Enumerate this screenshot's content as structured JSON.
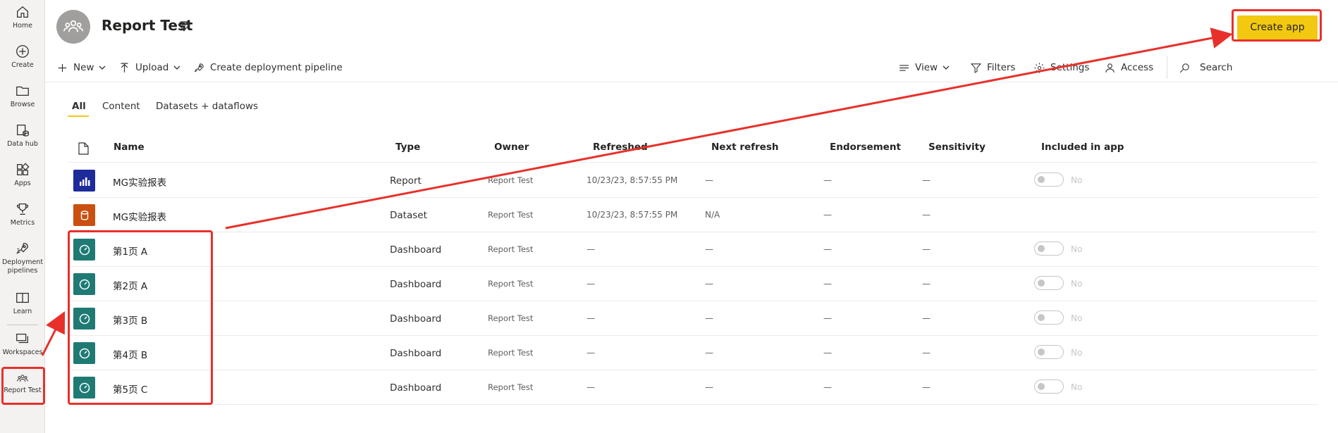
{
  "nav": [
    {
      "label": "Home",
      "icon": "home-icon"
    },
    {
      "label": "Create",
      "icon": "plus-circle-icon"
    },
    {
      "label": "Browse",
      "icon": "folder-icon"
    },
    {
      "label": "Data hub",
      "icon": "data-hub-icon"
    },
    {
      "label": "Apps",
      "icon": "apps-icon"
    },
    {
      "label": "Metrics",
      "icon": "trophy-icon"
    },
    {
      "label": "Deployment pipelines",
      "icon": "rocket-icon"
    },
    {
      "label": "Learn",
      "icon": "book-icon"
    },
    {
      "label": "Workspaces",
      "icon": "workspaces-icon"
    },
    {
      "label": "Report Test",
      "icon": "workspace-group-icon"
    }
  ],
  "header": {
    "title": "Report Test",
    "create_app_label": "Create app"
  },
  "toolbar": {
    "new_label": "New",
    "upload_label": "Upload",
    "pipeline_label": "Create deployment pipeline",
    "view_label": "View",
    "filters_label": "Filters",
    "settings_label": "Settings",
    "access_label": "Access",
    "search_label": "Search"
  },
  "tabs": [
    "All",
    "Content",
    "Datasets + dataflows"
  ],
  "table": {
    "headers": [
      "Name",
      "Type",
      "Owner",
      "Refreshed",
      "Next refresh",
      "Endorsement",
      "Sensitivity",
      "Included in app"
    ],
    "rows": [
      {
        "name": "MG实验报表",
        "type": "Report",
        "owner": "Report Test",
        "refreshed": "10/23/23, 8:57:55 PM",
        "next_refresh": "—",
        "endorsement": "—",
        "sensitivity": "—",
        "included": "No",
        "kind": "report"
      },
      {
        "name": "MG实验报表",
        "type": "Dataset",
        "owner": "Report Test",
        "refreshed": "10/23/23, 8:57:55 PM",
        "next_refresh": "N/A",
        "endorsement": "—",
        "sensitivity": "—",
        "included": "",
        "kind": "dataset"
      },
      {
        "name": "第1页 A",
        "type": "Dashboard",
        "owner": "Report Test",
        "refreshed": "—",
        "next_refresh": "—",
        "endorsement": "—",
        "sensitivity": "—",
        "included": "No",
        "kind": "dashboard"
      },
      {
        "name": "第2页 A",
        "type": "Dashboard",
        "owner": "Report Test",
        "refreshed": "—",
        "next_refresh": "—",
        "endorsement": "—",
        "sensitivity": "—",
        "included": "No",
        "kind": "dashboard"
      },
      {
        "name": "第3页 B",
        "type": "Dashboard",
        "owner": "Report Test",
        "refreshed": "—",
        "next_refresh": "—",
        "endorsement": "—",
        "sensitivity": "—",
        "included": "No",
        "kind": "dashboard"
      },
      {
        "name": "第4页 B",
        "type": "Dashboard",
        "owner": "Report Test",
        "refreshed": "—",
        "next_refresh": "—",
        "endorsement": "—",
        "sensitivity": "—",
        "included": "No",
        "kind": "dashboard"
      },
      {
        "name": "第5页 C",
        "type": "Dashboard",
        "owner": "Report Test",
        "refreshed": "—",
        "next_refresh": "—",
        "endorsement": "—",
        "sensitivity": "—",
        "included": "No",
        "kind": "dashboard"
      }
    ]
  },
  "colors": {
    "accent": "#f2c811",
    "report_tile": "#1e2b9b",
    "dataset_tile": "#ca5010",
    "dashboard_tile": "#1f7a74",
    "annotation": "#e8302a"
  }
}
